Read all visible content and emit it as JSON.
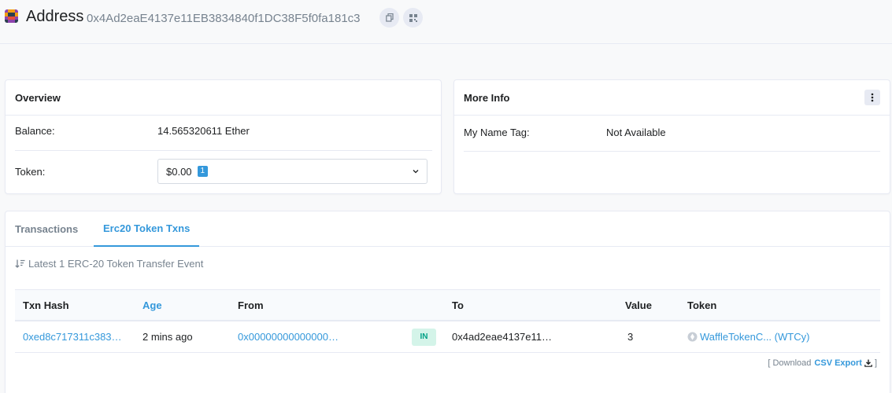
{
  "header": {
    "title": "Address",
    "address": "0x4Ad2eaE4137e11EB3834840f1DC38F5f0fa181c3"
  },
  "overview": {
    "title": "Overview",
    "balance_label": "Balance:",
    "balance_value": "14.565320611 Ether",
    "token_label": "Token:",
    "token_value": "$0.00",
    "token_count": "1"
  },
  "more_info": {
    "title": "More Info",
    "name_tag_label": "My Name Tag:",
    "name_tag_value": "Not Available"
  },
  "tabs": [
    {
      "label": "Transactions",
      "active": false
    },
    {
      "label": "Erc20 Token Txns",
      "active": true
    }
  ],
  "summary": "Latest 1 ERC-20 Token Transfer Event",
  "table": {
    "headers": {
      "txn_hash": "Txn Hash",
      "age": "Age",
      "from": "From",
      "to": "To",
      "value": "Value",
      "token": "Token"
    },
    "rows": [
      {
        "txn_hash": "0xed8c717311c383…",
        "age": "2 mins ago",
        "from": "0x00000000000000…",
        "direction": "IN",
        "to": "0x4ad2eae4137e11…",
        "value": "3",
        "token": "WaffleTokenC... (WTCy)"
      }
    ]
  },
  "csv": {
    "prefix": "[ Download",
    "link": "CSV Export",
    "suffix": "]"
  },
  "colors": {
    "accent": "#3498db",
    "in_badge_bg": "#d4f4e9",
    "in_badge_text": "#00a186"
  }
}
